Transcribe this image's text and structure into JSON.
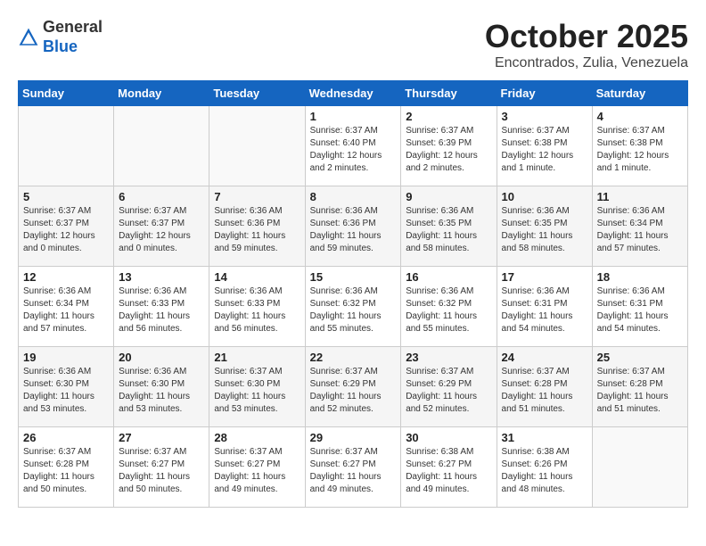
{
  "header": {
    "logo_general": "General",
    "logo_blue": "Blue",
    "month": "October 2025",
    "location": "Encontrados, Zulia, Venezuela"
  },
  "days_of_week": [
    "Sunday",
    "Monday",
    "Tuesday",
    "Wednesday",
    "Thursday",
    "Friday",
    "Saturday"
  ],
  "weeks": [
    [
      {
        "day": "",
        "info": ""
      },
      {
        "day": "",
        "info": ""
      },
      {
        "day": "",
        "info": ""
      },
      {
        "day": "1",
        "info": "Sunrise: 6:37 AM\nSunset: 6:40 PM\nDaylight: 12 hours\nand 2 minutes."
      },
      {
        "day": "2",
        "info": "Sunrise: 6:37 AM\nSunset: 6:39 PM\nDaylight: 12 hours\nand 2 minutes."
      },
      {
        "day": "3",
        "info": "Sunrise: 6:37 AM\nSunset: 6:38 PM\nDaylight: 12 hours\nand 1 minute."
      },
      {
        "day": "4",
        "info": "Sunrise: 6:37 AM\nSunset: 6:38 PM\nDaylight: 12 hours\nand 1 minute."
      }
    ],
    [
      {
        "day": "5",
        "info": "Sunrise: 6:37 AM\nSunset: 6:37 PM\nDaylight: 12 hours\nand 0 minutes."
      },
      {
        "day": "6",
        "info": "Sunrise: 6:37 AM\nSunset: 6:37 PM\nDaylight: 12 hours\nand 0 minutes."
      },
      {
        "day": "7",
        "info": "Sunrise: 6:36 AM\nSunset: 6:36 PM\nDaylight: 11 hours\nand 59 minutes."
      },
      {
        "day": "8",
        "info": "Sunrise: 6:36 AM\nSunset: 6:36 PM\nDaylight: 11 hours\nand 59 minutes."
      },
      {
        "day": "9",
        "info": "Sunrise: 6:36 AM\nSunset: 6:35 PM\nDaylight: 11 hours\nand 58 minutes."
      },
      {
        "day": "10",
        "info": "Sunrise: 6:36 AM\nSunset: 6:35 PM\nDaylight: 11 hours\nand 58 minutes."
      },
      {
        "day": "11",
        "info": "Sunrise: 6:36 AM\nSunset: 6:34 PM\nDaylight: 11 hours\nand 57 minutes."
      }
    ],
    [
      {
        "day": "12",
        "info": "Sunrise: 6:36 AM\nSunset: 6:34 PM\nDaylight: 11 hours\nand 57 minutes."
      },
      {
        "day": "13",
        "info": "Sunrise: 6:36 AM\nSunset: 6:33 PM\nDaylight: 11 hours\nand 56 minutes."
      },
      {
        "day": "14",
        "info": "Sunrise: 6:36 AM\nSunset: 6:33 PM\nDaylight: 11 hours\nand 56 minutes."
      },
      {
        "day": "15",
        "info": "Sunrise: 6:36 AM\nSunset: 6:32 PM\nDaylight: 11 hours\nand 55 minutes."
      },
      {
        "day": "16",
        "info": "Sunrise: 6:36 AM\nSunset: 6:32 PM\nDaylight: 11 hours\nand 55 minutes."
      },
      {
        "day": "17",
        "info": "Sunrise: 6:36 AM\nSunset: 6:31 PM\nDaylight: 11 hours\nand 54 minutes."
      },
      {
        "day": "18",
        "info": "Sunrise: 6:36 AM\nSunset: 6:31 PM\nDaylight: 11 hours\nand 54 minutes."
      }
    ],
    [
      {
        "day": "19",
        "info": "Sunrise: 6:36 AM\nSunset: 6:30 PM\nDaylight: 11 hours\nand 53 minutes."
      },
      {
        "day": "20",
        "info": "Sunrise: 6:36 AM\nSunset: 6:30 PM\nDaylight: 11 hours\nand 53 minutes."
      },
      {
        "day": "21",
        "info": "Sunrise: 6:37 AM\nSunset: 6:30 PM\nDaylight: 11 hours\nand 53 minutes."
      },
      {
        "day": "22",
        "info": "Sunrise: 6:37 AM\nSunset: 6:29 PM\nDaylight: 11 hours\nand 52 minutes."
      },
      {
        "day": "23",
        "info": "Sunrise: 6:37 AM\nSunset: 6:29 PM\nDaylight: 11 hours\nand 52 minutes."
      },
      {
        "day": "24",
        "info": "Sunrise: 6:37 AM\nSunset: 6:28 PM\nDaylight: 11 hours\nand 51 minutes."
      },
      {
        "day": "25",
        "info": "Sunrise: 6:37 AM\nSunset: 6:28 PM\nDaylight: 11 hours\nand 51 minutes."
      }
    ],
    [
      {
        "day": "26",
        "info": "Sunrise: 6:37 AM\nSunset: 6:28 PM\nDaylight: 11 hours\nand 50 minutes."
      },
      {
        "day": "27",
        "info": "Sunrise: 6:37 AM\nSunset: 6:27 PM\nDaylight: 11 hours\nand 50 minutes."
      },
      {
        "day": "28",
        "info": "Sunrise: 6:37 AM\nSunset: 6:27 PM\nDaylight: 11 hours\nand 49 minutes."
      },
      {
        "day": "29",
        "info": "Sunrise: 6:37 AM\nSunset: 6:27 PM\nDaylight: 11 hours\nand 49 minutes."
      },
      {
        "day": "30",
        "info": "Sunrise: 6:38 AM\nSunset: 6:27 PM\nDaylight: 11 hours\nand 49 minutes."
      },
      {
        "day": "31",
        "info": "Sunrise: 6:38 AM\nSunset: 6:26 PM\nDaylight: 11 hours\nand 48 minutes."
      },
      {
        "day": "",
        "info": ""
      }
    ]
  ]
}
